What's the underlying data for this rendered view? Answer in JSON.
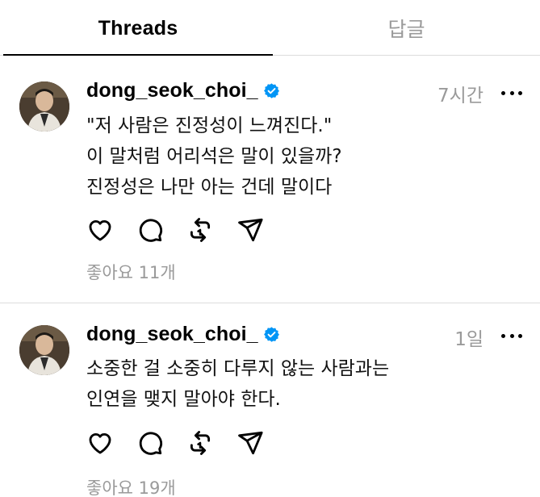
{
  "tabs": [
    {
      "label": "Threads"
    },
    {
      "label": "답글"
    }
  ],
  "posts": [
    {
      "username": "dong_seok_choi_",
      "timestamp": "7시간",
      "lines": [
        "\"저 사람은 진정성이 느껴진다.\"",
        "이 말처럼 어리석은 말이 있을까?",
        "진정성은 나만 아는 건데 말이다"
      ],
      "likes": "좋아요 11개"
    },
    {
      "username": "dong_seok_choi_",
      "timestamp": "1일",
      "lines": [
        "소중한 걸 소중히 다루지 않는 사람과는",
        "인연을 맺지 말아야 한다."
      ],
      "likes": "좋아요 19개"
    }
  ],
  "colors": {
    "verified": "#0095f6",
    "muted": "#9a9a9a",
    "divider": "#dcdcdc"
  },
  "icons": {
    "like": "heart-icon",
    "comment": "comment-bubble-icon",
    "repost": "repost-icon",
    "share": "send-icon",
    "more": "more-horizontal-icon",
    "verified": "verified-badge-icon"
  }
}
